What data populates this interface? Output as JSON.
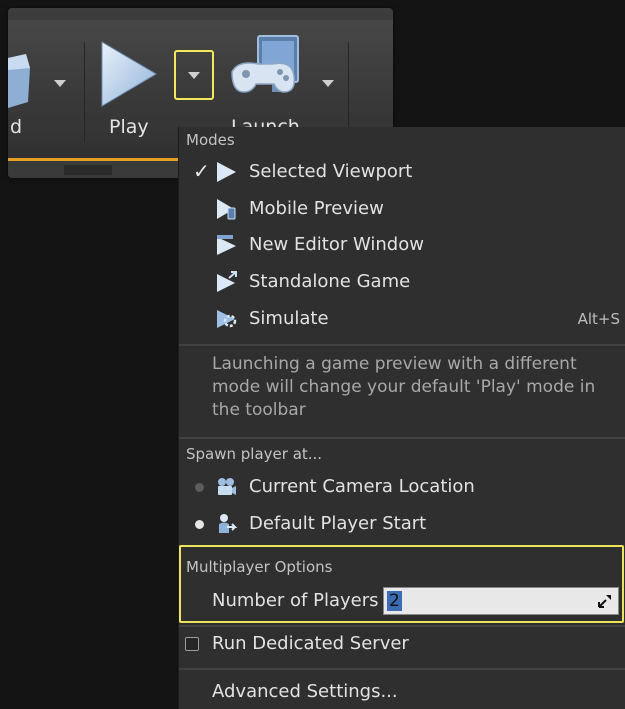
{
  "toolbar": {
    "left_label_fragment": "d",
    "play_label": "Play",
    "launch_label": "Launch"
  },
  "menu": {
    "modes_header": "Modes",
    "modes": [
      {
        "label": "Selected Viewport",
        "checked": true,
        "icon": "play-viewport-icon",
        "shortcut": ""
      },
      {
        "label": "Mobile Preview",
        "checked": false,
        "icon": "mobile-preview-icon",
        "shortcut": ""
      },
      {
        "label": "New Editor Window",
        "checked": false,
        "icon": "new-window-icon",
        "shortcut": ""
      },
      {
        "label": "Standalone Game",
        "checked": false,
        "icon": "standalone-game-icon",
        "shortcut": ""
      },
      {
        "label": "Simulate",
        "checked": false,
        "icon": "simulate-icon",
        "shortcut": "Alt+S"
      }
    ],
    "check_glyph": "✓",
    "note": "Launching a game preview with a different mode will change your default 'Play' mode in the toolbar",
    "spawn_header": "Spawn player at...",
    "spawn_options": [
      {
        "label": "Current Camera Location",
        "selected": false,
        "icon": "camera-icon"
      },
      {
        "label": "Default Player Start",
        "selected": true,
        "icon": "player-start-icon"
      }
    ],
    "multiplayer_header": "Multiplayer Options",
    "players_label": "Number of Players",
    "players_value": "2",
    "dedicated_server_label": "Run Dedicated Server",
    "dedicated_server_checked": false,
    "advanced_label": "Advanced Settings..."
  },
  "colors": {
    "highlight": "#ece45a",
    "accent_icon": "#c9dcf2",
    "progress": "#e4a020"
  }
}
